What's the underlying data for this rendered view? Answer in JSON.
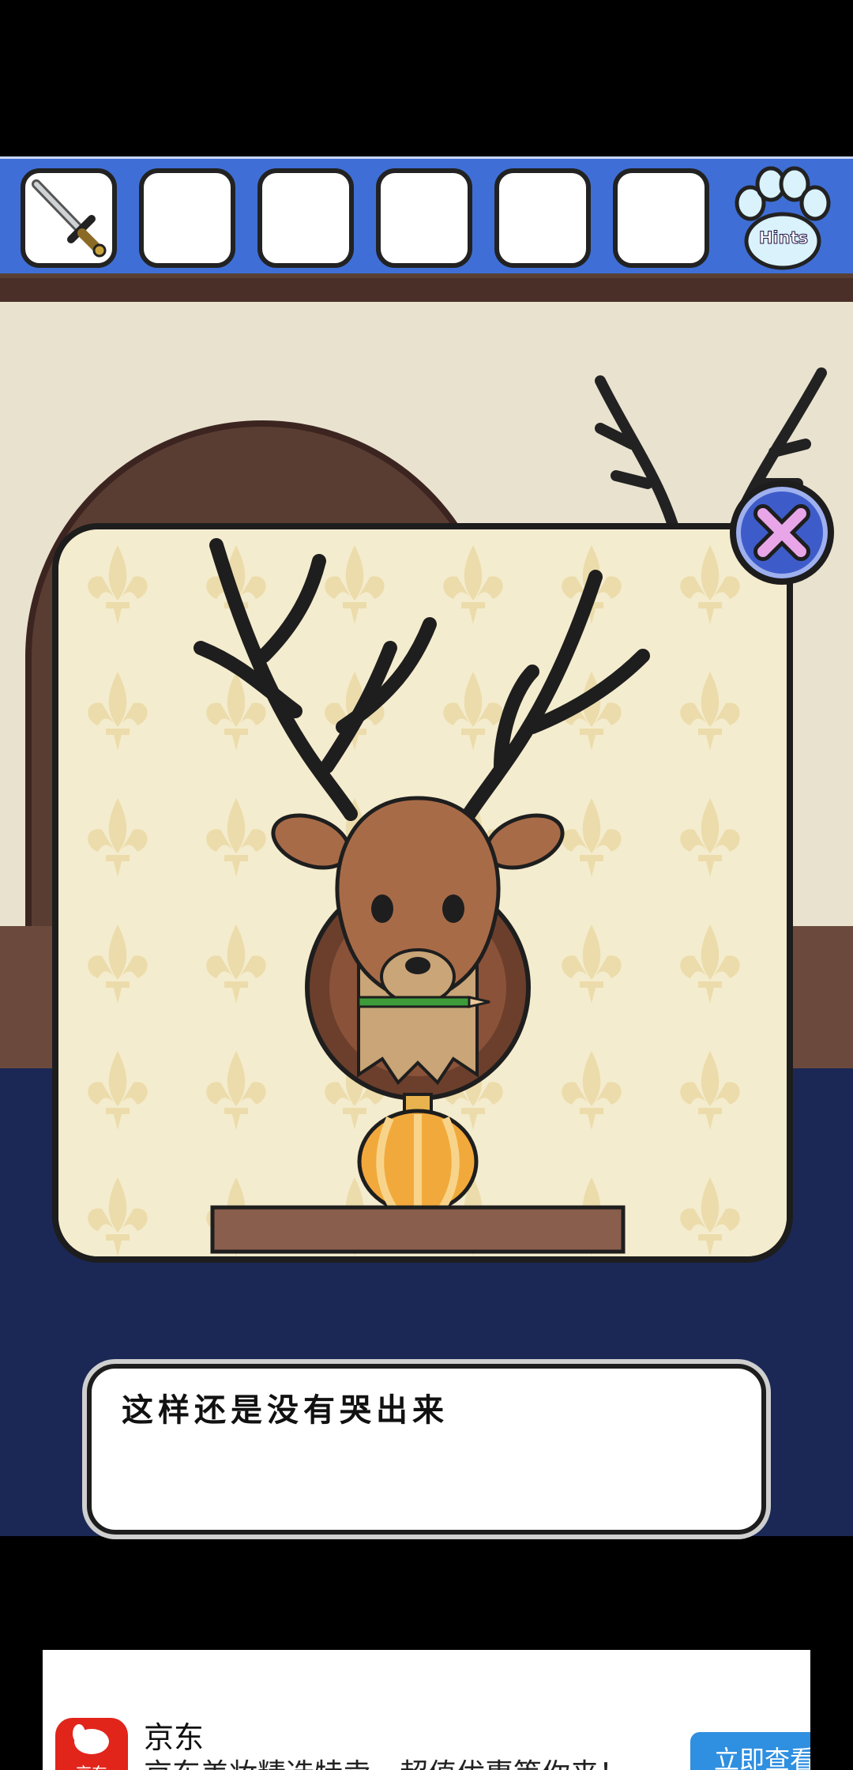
{
  "inventory": {
    "slots": [
      {
        "item": "sword-icon"
      },
      {
        "item": ""
      },
      {
        "item": ""
      },
      {
        "item": ""
      },
      {
        "item": ""
      },
      {
        "item": ""
      }
    ],
    "hints_label": "Hints"
  },
  "dialogue": {
    "text": "这样还是没有哭出来"
  },
  "ad": {
    "logo_text": "京东",
    "title": "京东",
    "description": "京东美妆精选特卖，超值优惠等你来！",
    "cta": "立即查看"
  },
  "colors": {
    "inventory_bar": "#3f6fd6",
    "close_button": "#3e5cc9",
    "close_x": "#e8a6e8",
    "ad_logo": "#e1251b",
    "ad_cta": "#2f8fe0"
  }
}
